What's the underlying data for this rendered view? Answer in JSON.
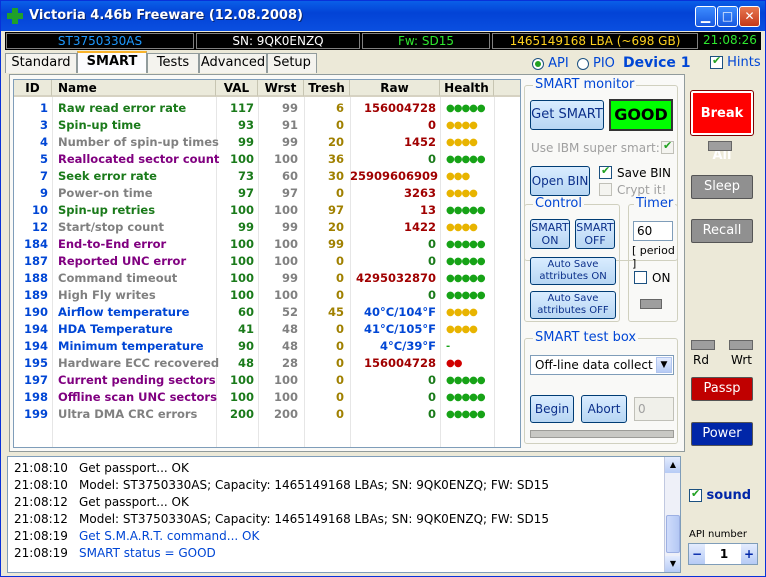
{
  "window": {
    "title": "Victoria 4.46b Freeware (12.08.2008)"
  },
  "infobar": {
    "model": "ST3750330AS",
    "serial": "SN: 9QK0ENZQ",
    "firmware": "Fw: SD15",
    "lba": "1465149168 LBA (~698 GB)",
    "time": "21:08:26"
  },
  "tabs": [
    "Standard",
    "SMART",
    "Tests",
    "Advanced",
    "Setup"
  ],
  "mode": {
    "api_label": "API",
    "pio_label": "PIO",
    "device_label": "Device 1",
    "hints_label": "Hints",
    "api_selected": true,
    "hints_checked": true
  },
  "table": {
    "headers": [
      "ID",
      "Name",
      "VAL",
      "Wrst",
      "Tresh",
      "Raw",
      "Health"
    ],
    "rows": [
      {
        "id": "1",
        "name": "Raw read error rate",
        "val": "117",
        "wrst": "99",
        "tresh": "6",
        "raw": "156004728",
        "health": "●●●●●",
        "name_color": "#1a7a1a",
        "raw_color": "#a00000",
        "health_color": "#17a317"
      },
      {
        "id": "3",
        "name": "Spin-up time",
        "val": "93",
        "wrst": "91",
        "tresh": "0",
        "raw": "0",
        "health": "●●●●",
        "name_color": "#1a7a1a",
        "raw_color": "#a00000",
        "health_color": "#e8b400"
      },
      {
        "id": "4",
        "name": "Number of spin-up times",
        "val": "99",
        "wrst": "99",
        "tresh": "20",
        "raw": "1452",
        "health": "●●●●",
        "name_color": "#808080",
        "raw_color": "#a00000",
        "health_color": "#e8b400"
      },
      {
        "id": "5",
        "name": "Reallocated sector count",
        "val": "100",
        "wrst": "100",
        "tresh": "36",
        "raw": "0",
        "health": "●●●●●",
        "name_color": "#800080",
        "raw_color": "#1a7a1a",
        "health_color": "#17a317"
      },
      {
        "id": "7",
        "name": "Seek error rate",
        "val": "73",
        "wrst": "60",
        "tresh": "30",
        "raw": "25909606909",
        "health": "●●●",
        "name_color": "#1a7a1a",
        "raw_color": "#a00000",
        "health_color": "#e8b400"
      },
      {
        "id": "9",
        "name": "Power-on time",
        "val": "97",
        "wrst": "97",
        "tresh": "0",
        "raw": "3263",
        "health": "●●●●",
        "name_color": "#808080",
        "raw_color": "#a00000",
        "health_color": "#e8b400"
      },
      {
        "id": "10",
        "name": "Spin-up retries",
        "val": "100",
        "wrst": "100",
        "tresh": "97",
        "raw": "13",
        "health": "●●●●●",
        "name_color": "#1a7a1a",
        "raw_color": "#a00000",
        "health_color": "#17a317"
      },
      {
        "id": "12",
        "name": "Start/stop count",
        "val": "99",
        "wrst": "99",
        "tresh": "20",
        "raw": "1422",
        "health": "●●●●",
        "name_color": "#808080",
        "raw_color": "#a00000",
        "health_color": "#e8b400"
      },
      {
        "id": "184",
        "name": "End-to-End error",
        "val": "100",
        "wrst": "100",
        "tresh": "99",
        "raw": "0",
        "health": "●●●●●",
        "name_color": "#800080",
        "raw_color": "#1a7a1a",
        "health_color": "#17a317"
      },
      {
        "id": "187",
        "name": "Reported UNC error",
        "val": "100",
        "wrst": "100",
        "tresh": "0",
        "raw": "0",
        "health": "●●●●●",
        "name_color": "#800080",
        "raw_color": "#1a7a1a",
        "health_color": "#17a317"
      },
      {
        "id": "188",
        "name": "Command timeout",
        "val": "100",
        "wrst": "99",
        "tresh": "0",
        "raw": "4295032870",
        "health": "●●●●●",
        "name_color": "#808080",
        "raw_color": "#a00000",
        "health_color": "#17a317"
      },
      {
        "id": "189",
        "name": "High Fly writes",
        "val": "100",
        "wrst": "100",
        "tresh": "0",
        "raw": "0",
        "health": "●●●●●",
        "name_color": "#808080",
        "raw_color": "#1a7a1a",
        "health_color": "#17a317"
      },
      {
        "id": "190",
        "name": "Airflow temperature",
        "val": "60",
        "wrst": "52",
        "tresh": "45",
        "raw": "40°C/104°F",
        "health": "●●●●",
        "name_color": "#0046d5",
        "raw_color": "#0046d5",
        "health_color": "#e8b400"
      },
      {
        "id": "194",
        "name": "HDA Temperature",
        "val": "41",
        "wrst": "48",
        "tresh": "0",
        "raw": "41°C/105°F",
        "health": "●●●●",
        "name_color": "#0046d5",
        "raw_color": "#0046d5",
        "health_color": "#e8b400"
      },
      {
        "id": "194",
        "name": "Minimum temperature",
        "val": "90",
        "wrst": "48",
        "tresh": "0",
        "raw": "4°C/39°F",
        "health": "-",
        "name_color": "#0046d5",
        "raw_color": "#0046d5",
        "health_color": "#17a317"
      },
      {
        "id": "195",
        "name": "Hardware ECC recovered",
        "val": "48",
        "wrst": "28",
        "tresh": "0",
        "raw": "156004728",
        "health": "●●",
        "name_color": "#808080",
        "raw_color": "#a00000",
        "health_color": "#d00000"
      },
      {
        "id": "197",
        "name": "Current pending sectors",
        "val": "100",
        "wrst": "100",
        "tresh": "0",
        "raw": "0",
        "health": "●●●●●",
        "name_color": "#800080",
        "raw_color": "#1a7a1a",
        "health_color": "#17a317"
      },
      {
        "id": "198",
        "name": "Offline scan UNC sectors",
        "val": "100",
        "wrst": "100",
        "tresh": "0",
        "raw": "0",
        "health": "●●●●●",
        "name_color": "#800080",
        "raw_color": "#1a7a1a",
        "health_color": "#17a317"
      },
      {
        "id": "199",
        "name": "Ultra DMA CRC errors",
        "val": "200",
        "wrst": "200",
        "tresh": "0",
        "raw": "0",
        "health": "●●●●●",
        "name_color": "#808080",
        "raw_color": "#1a7a1a",
        "health_color": "#17a317"
      }
    ]
  },
  "smart_monitor": {
    "title": "SMART monitor",
    "get_smart": "Get SMART",
    "status": "GOOD",
    "ibm_label": "Use IBM super smart:",
    "open_bin": "Open BIN",
    "save_bin": "Save BIN",
    "crypt": "Crypt it!"
  },
  "control": {
    "title": "Control",
    "smart_on": "SMART ON",
    "smart_off": "SMART OFF",
    "autosave_on": "Auto Save attributes ON",
    "autosave_off": "Auto Save attributes OFF"
  },
  "timer": {
    "title": "Timer",
    "value": "60",
    "period": "[ period ]",
    "on_label": "ON"
  },
  "test_box": {
    "title": "SMART test box",
    "selected": "Off-line data collect",
    "begin": "Begin",
    "abort": "Abort",
    "counter": "0"
  },
  "right": {
    "break_all": "Break All",
    "sleep": "Sleep",
    "recall": "Recall",
    "rd": "Rd",
    "wrt": "Wrt",
    "passp": "Passp",
    "power": "Power",
    "sound": "sound",
    "api_number_label": "API number",
    "api_number": "1",
    "minus": "−",
    "plus": "+"
  },
  "log": [
    {
      "time": "21:08:10",
      "text": "Get passport... OK",
      "color": "#000000"
    },
    {
      "time": "21:08:10",
      "text": "Model: ST3750330AS; Capacity: 1465149168 LBAs; SN: 9QK0ENZQ; FW: SD15",
      "color": "#000000"
    },
    {
      "time": "21:08:12",
      "text": "Get passport... OK",
      "color": "#000000"
    },
    {
      "time": "21:08:12",
      "text": "Model: ST3750330AS; Capacity: 1465149168 LBAs; SN: 9QK0ENZQ; FW: SD15",
      "color": "#000000"
    },
    {
      "time": "21:08:19",
      "text": "Get S.M.A.R.T. command... OK",
      "color": "#0046d5"
    },
    {
      "time": "21:08:19",
      "text": "SMART status = GOOD",
      "color": "#0046d5"
    }
  ]
}
